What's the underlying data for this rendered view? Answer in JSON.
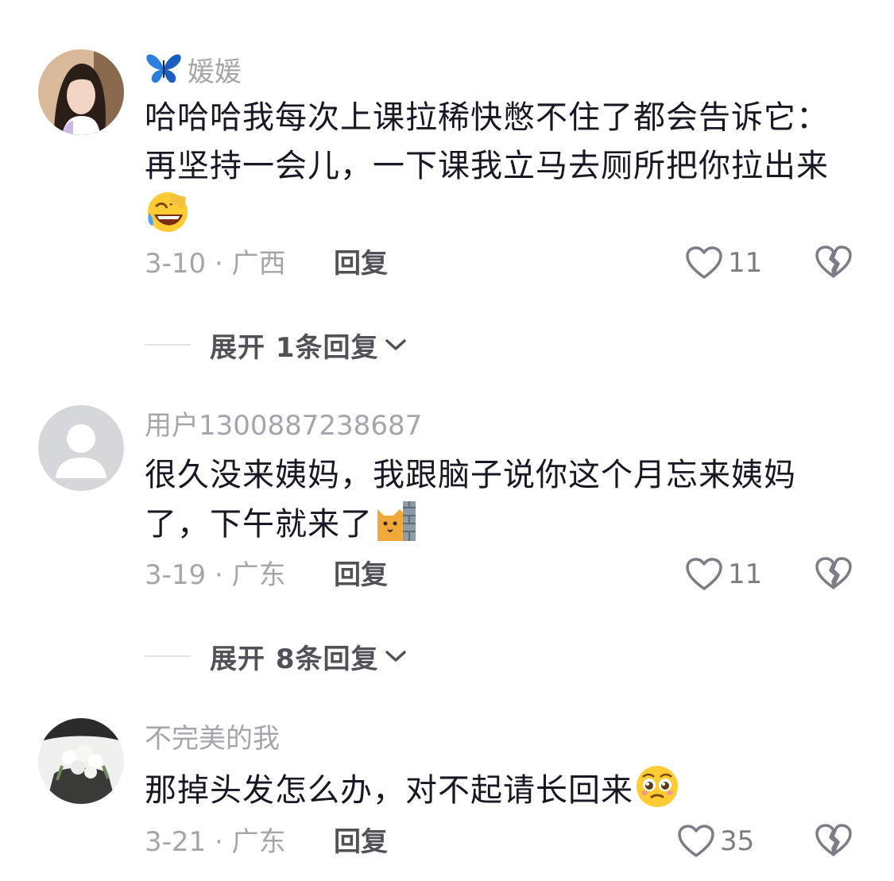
{
  "comments": [
    {
      "username": "媛媛",
      "text": "哈哈哈我每次上课拉稀快憋不住了都会告诉它：再坚持一会儿，一下课我立马去厕所把你拉出来",
      "date_location": "3-10 · 广西",
      "reply_label": "回复",
      "likes": "11",
      "expand_label": "展开 1条回复",
      "emoji": "rofl-emoji"
    },
    {
      "username": "用户1300887238687",
      "text": "很久没来姨妈，我跟脑子说你这个月忘来姨妈了，下午就来了",
      "date_location": "3-19 · 广东",
      "reply_label": "回复",
      "likes": "11",
      "expand_label": "展开 8条回复",
      "emoji": "cat-peeking-emoji"
    },
    {
      "username": "不完美的我",
      "text": "那掉头发怎么办，对不起请长回来",
      "date_location": "3-21 · 广东",
      "reply_label": "回复",
      "likes": "35",
      "emoji": "pleading-emoji"
    }
  ],
  "colors": {
    "text": "#161823",
    "secondary": "#a3a6ad",
    "reply": "#505258"
  }
}
